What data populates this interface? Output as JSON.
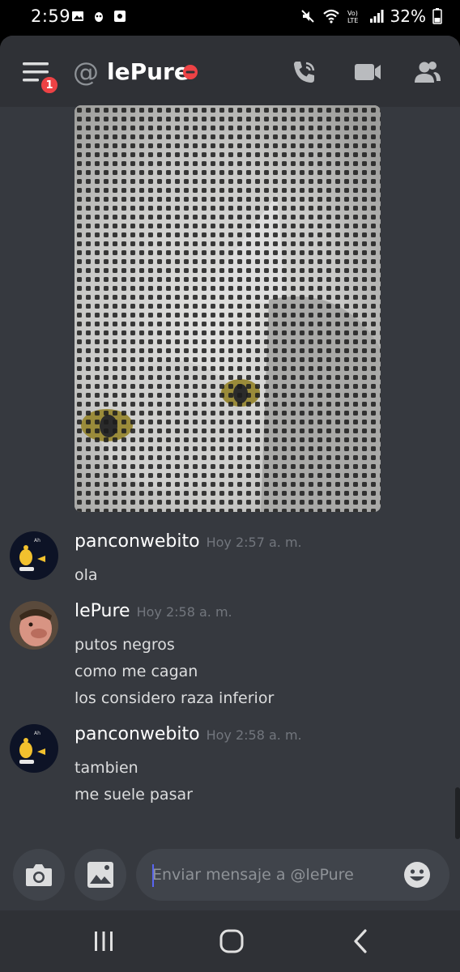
{
  "status_bar": {
    "time": "2:59",
    "battery": "32%",
    "left_icons": [
      "gallery-icon",
      "bug-icon",
      "screenshot-icon"
    ],
    "right_icons": [
      "mute-icon",
      "wifi-icon",
      "volte-icon",
      "signal-icon",
      "battery-icon"
    ]
  },
  "header": {
    "channel_name": "lePure",
    "unread_badge": "1",
    "user_status": "do-not-disturb",
    "status_color": "#ed4245",
    "actions": [
      "call-icon",
      "video-icon",
      "members-icon"
    ]
  },
  "messages": [
    {
      "author": "panconwebito",
      "timestamp": "Hoy 2:57 a. m.",
      "lines": [
        "ola"
      ]
    },
    {
      "author": "lePure",
      "timestamp": "Hoy 2:58 a. m.",
      "lines": [
        "putos negros",
        "como me cagan",
        "los considero raza inferior"
      ]
    },
    {
      "author": "panconwebito",
      "timestamp": "Hoy 2:58 a. m.",
      "lines": [
        "tambien",
        "me suele pasar"
      ]
    }
  ],
  "composer": {
    "placeholder": "Enviar mensaje a @lePure",
    "value": ""
  },
  "colors": {
    "background": "#36393f",
    "header": "#2f3136",
    "input": "#40444b",
    "accent": "#5865f2",
    "timestamp": "#72767d"
  }
}
